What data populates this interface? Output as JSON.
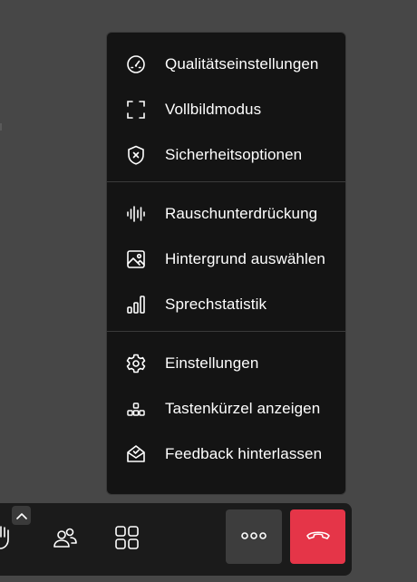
{
  "menu": {
    "groups": [
      [
        {
          "label": "Qualitätseinstellungen",
          "icon": "gauge-icon"
        },
        {
          "label": "Vollbildmodus",
          "icon": "fullscreen-icon"
        },
        {
          "label": "Sicherheitsoptionen",
          "icon": "shield-icon"
        }
      ],
      [
        {
          "label": "Rauschunterdrückung",
          "icon": "audio-waveform-icon"
        },
        {
          "label": "Hintergrund auswählen",
          "icon": "image-icon"
        },
        {
          "label": "Sprechstatistik",
          "icon": "bar-chart-icon"
        }
      ],
      [
        {
          "label": "Einstellungen",
          "icon": "gear-icon"
        },
        {
          "label": "Tastenkürzel anzeigen",
          "icon": "keyboard-shortcuts-icon"
        },
        {
          "label": "Feedback hinterlassen",
          "icon": "feedback-icon"
        }
      ]
    ]
  },
  "toolbar": {
    "buttons": [
      "raise-hand-icon",
      "participants-icon",
      "tile-view-icon",
      "more-options-icon",
      "hang-up-icon"
    ]
  },
  "colors": {
    "background": "#474747",
    "menu": "#141414",
    "hangup": "#e53548"
  }
}
